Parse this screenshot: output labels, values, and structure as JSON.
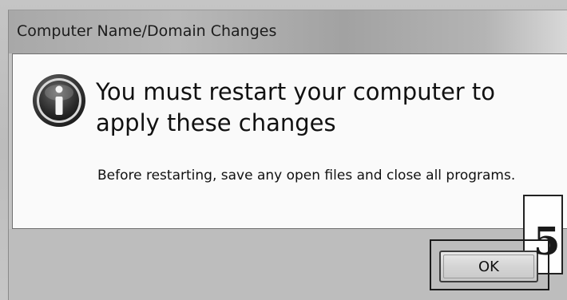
{
  "window": {
    "title": "Computer Name/Domain Changes"
  },
  "message": {
    "icon": "info-icon",
    "heading": "You must restart your computer to apply these changes",
    "body": "Before restarting, save any open files and close all programs."
  },
  "buttons": {
    "ok_label": "OK"
  },
  "annotation": {
    "callout_number": "5"
  },
  "colors": {
    "titlebar": "#b0b0b0",
    "content_background": "#fafafa",
    "footer": "#bdbdbd",
    "icon_dark": "#2a2a2a"
  }
}
